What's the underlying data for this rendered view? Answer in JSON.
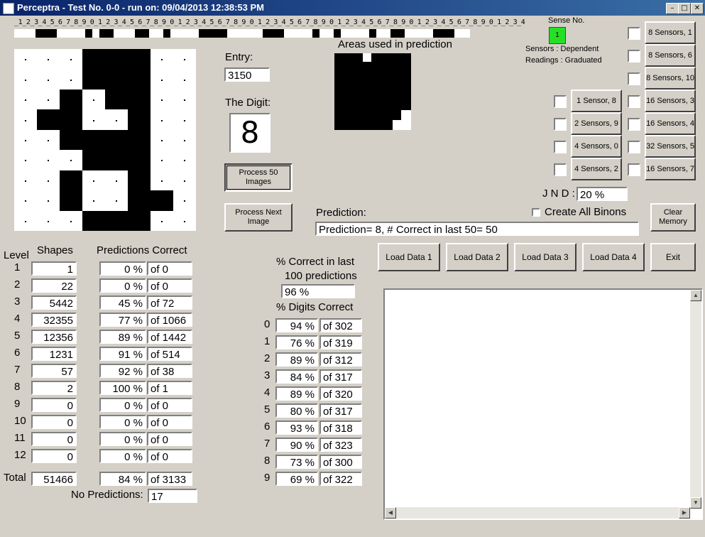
{
  "window": {
    "title": "Perceptra - Test No. 0-0 - run on: 09/04/2013  12:38:53 PM"
  },
  "ruler": {
    "text": "_1_2_3_4_5_6_7_8_9_0_1_2_3_4_5_6_7_8_9_0_1_2_3_4_5_6_7_8_9_0_1_2_3_4_5_6_7_8_9_0_1_2_3_4_5_6_7_8_9_0_1_2_3_4_5_6_7_8_9_0_1_2_3_4"
  },
  "entry": {
    "label": "Entry:",
    "value": "3150"
  },
  "digit": {
    "label": "The Digit:",
    "value": "8"
  },
  "areas": {
    "label": "Areas used in prediction"
  },
  "sense": {
    "label": "Sense No.",
    "value": "1",
    "sensors_line": "Sensors   :  Dependent",
    "readings_line": "Readings :  Graduated"
  },
  "buttons": {
    "process50": "Process 50 Images",
    "processNext": "Process Next Image",
    "clearMemory": "Clear Memory",
    "load1": "Load Data 1",
    "load2": "Load Data 2",
    "load3": "Load Data 3",
    "load4": "Load Data 4",
    "exit": "Exit"
  },
  "sensor_buttons_right": [
    "8 Sensors, 1",
    "8 Sensors, 6",
    "8 Sensors, 10",
    "16 Sensors, 3",
    "16 Sensors, 4",
    "32 Sensors, 5",
    "16 Sensors, 7"
  ],
  "sensor_buttons_left": [
    "1 Sensor, 8",
    "2 Sensors, 9",
    "4 Sensors, 0",
    "4 Sensors, 2"
  ],
  "jnd": {
    "label": "J N D :",
    "value": "20 %"
  },
  "create_binons": {
    "label": "Create All Binons"
  },
  "prediction": {
    "label": "Prediction:",
    "value": "Prediction= 8, # Correct in last 50= 50"
  },
  "level_table": {
    "h_level": "Level",
    "h_shapes": "Shapes",
    "h_pred": "Predictions Correct",
    "rows": [
      {
        "level": "1",
        "shapes": "1",
        "pct": "0 %",
        "of": "of 0"
      },
      {
        "level": "2",
        "shapes": "22",
        "pct": "0 %",
        "of": "of 0"
      },
      {
        "level": "3",
        "shapes": "5442",
        "pct": "45 %",
        "of": "of 72"
      },
      {
        "level": "4",
        "shapes": "32355",
        "pct": "77 %",
        "of": "of 1066"
      },
      {
        "level": "5",
        "shapes": "12356",
        "pct": "89 %",
        "of": "of 1442"
      },
      {
        "level": "6",
        "shapes": "1231",
        "pct": "91 %",
        "of": "of 514"
      },
      {
        "level": "7",
        "shapes": "57",
        "pct": "92 %",
        "of": "of 38"
      },
      {
        "level": "8",
        "shapes": "2",
        "pct": "100 %",
        "of": "of 1"
      },
      {
        "level": "9",
        "shapes": "0",
        "pct": "0 %",
        "of": "of 0"
      },
      {
        "level": "10",
        "shapes": "0",
        "pct": "0 %",
        "of": "of 0"
      },
      {
        "level": "11",
        "shapes": "0",
        "pct": "0 %",
        "of": "of 0"
      },
      {
        "level": "12",
        "shapes": "0",
        "pct": "0 %",
        "of": "of 0"
      }
    ],
    "total_label": "Total",
    "total_shapes": "51466",
    "total_pct": "84 %",
    "total_of": "of 3133",
    "no_pred_label": "No Predictions:",
    "no_pred_value": "17"
  },
  "last100": {
    "label1": "% Correct in last",
    "label2": "100 predictions",
    "value": "96 %"
  },
  "digits_table": {
    "label": "% Digits Correct",
    "rows": [
      {
        "d": "0",
        "pct": "94 %",
        "of": "of 302"
      },
      {
        "d": "1",
        "pct": "76 %",
        "of": "of 319"
      },
      {
        "d": "2",
        "pct": "89 %",
        "of": "of 312"
      },
      {
        "d": "3",
        "pct": "84 %",
        "of": "of 317"
      },
      {
        "d": "4",
        "pct": "89 %",
        "of": "of 320"
      },
      {
        "d": "5",
        "pct": "80 %",
        "of": "of 317"
      },
      {
        "d": "6",
        "pct": "93 %",
        "of": "of 318"
      },
      {
        "d": "7",
        "pct": "90 %",
        "of": "of 323"
      },
      {
        "d": "8",
        "pct": "73 %",
        "of": "of 300"
      },
      {
        "d": "9",
        "pct": "69 %",
        "of": "of 322"
      }
    ]
  },
  "image_grid": [
    [
      0,
      0,
      0,
      1,
      1,
      1,
      0,
      0
    ],
    [
      0,
      0,
      0,
      1,
      1,
      1,
      0,
      0
    ],
    [
      0,
      0,
      1,
      0,
      1,
      1,
      0,
      0
    ],
    [
      0,
      1,
      1,
      0,
      0,
      1,
      0,
      0
    ],
    [
      0,
      0,
      1,
      1,
      1,
      1,
      0,
      0
    ],
    [
      0,
      0,
      0,
      1,
      1,
      1,
      0,
      0
    ],
    [
      0,
      0,
      1,
      0,
      0,
      1,
      0,
      0
    ],
    [
      0,
      0,
      1,
      0,
      0,
      1,
      1,
      0
    ],
    [
      0,
      0,
      0,
      1,
      1,
      1,
      0,
      0
    ]
  ],
  "ruler_marks": [
    [
      1,
      1,
      0,
      0,
      0,
      0,
      0,
      0,
      1,
      1
    ],
    [
      0,
      0,
      0,
      0,
      0,
      0,
      0,
      0,
      0,
      0
    ]
  ],
  "colors": {
    "face": "#d4d0c8",
    "sense_active": "#26e026",
    "title_start": "#0a246a",
    "title_end": "#3a6ea5"
  },
  "icons": [
    "app-icon",
    "minimize-icon",
    "maximize-icon",
    "close-icon",
    "scroll-up-icon",
    "scroll-down-icon",
    "scroll-left-icon",
    "scroll-right-icon"
  ]
}
